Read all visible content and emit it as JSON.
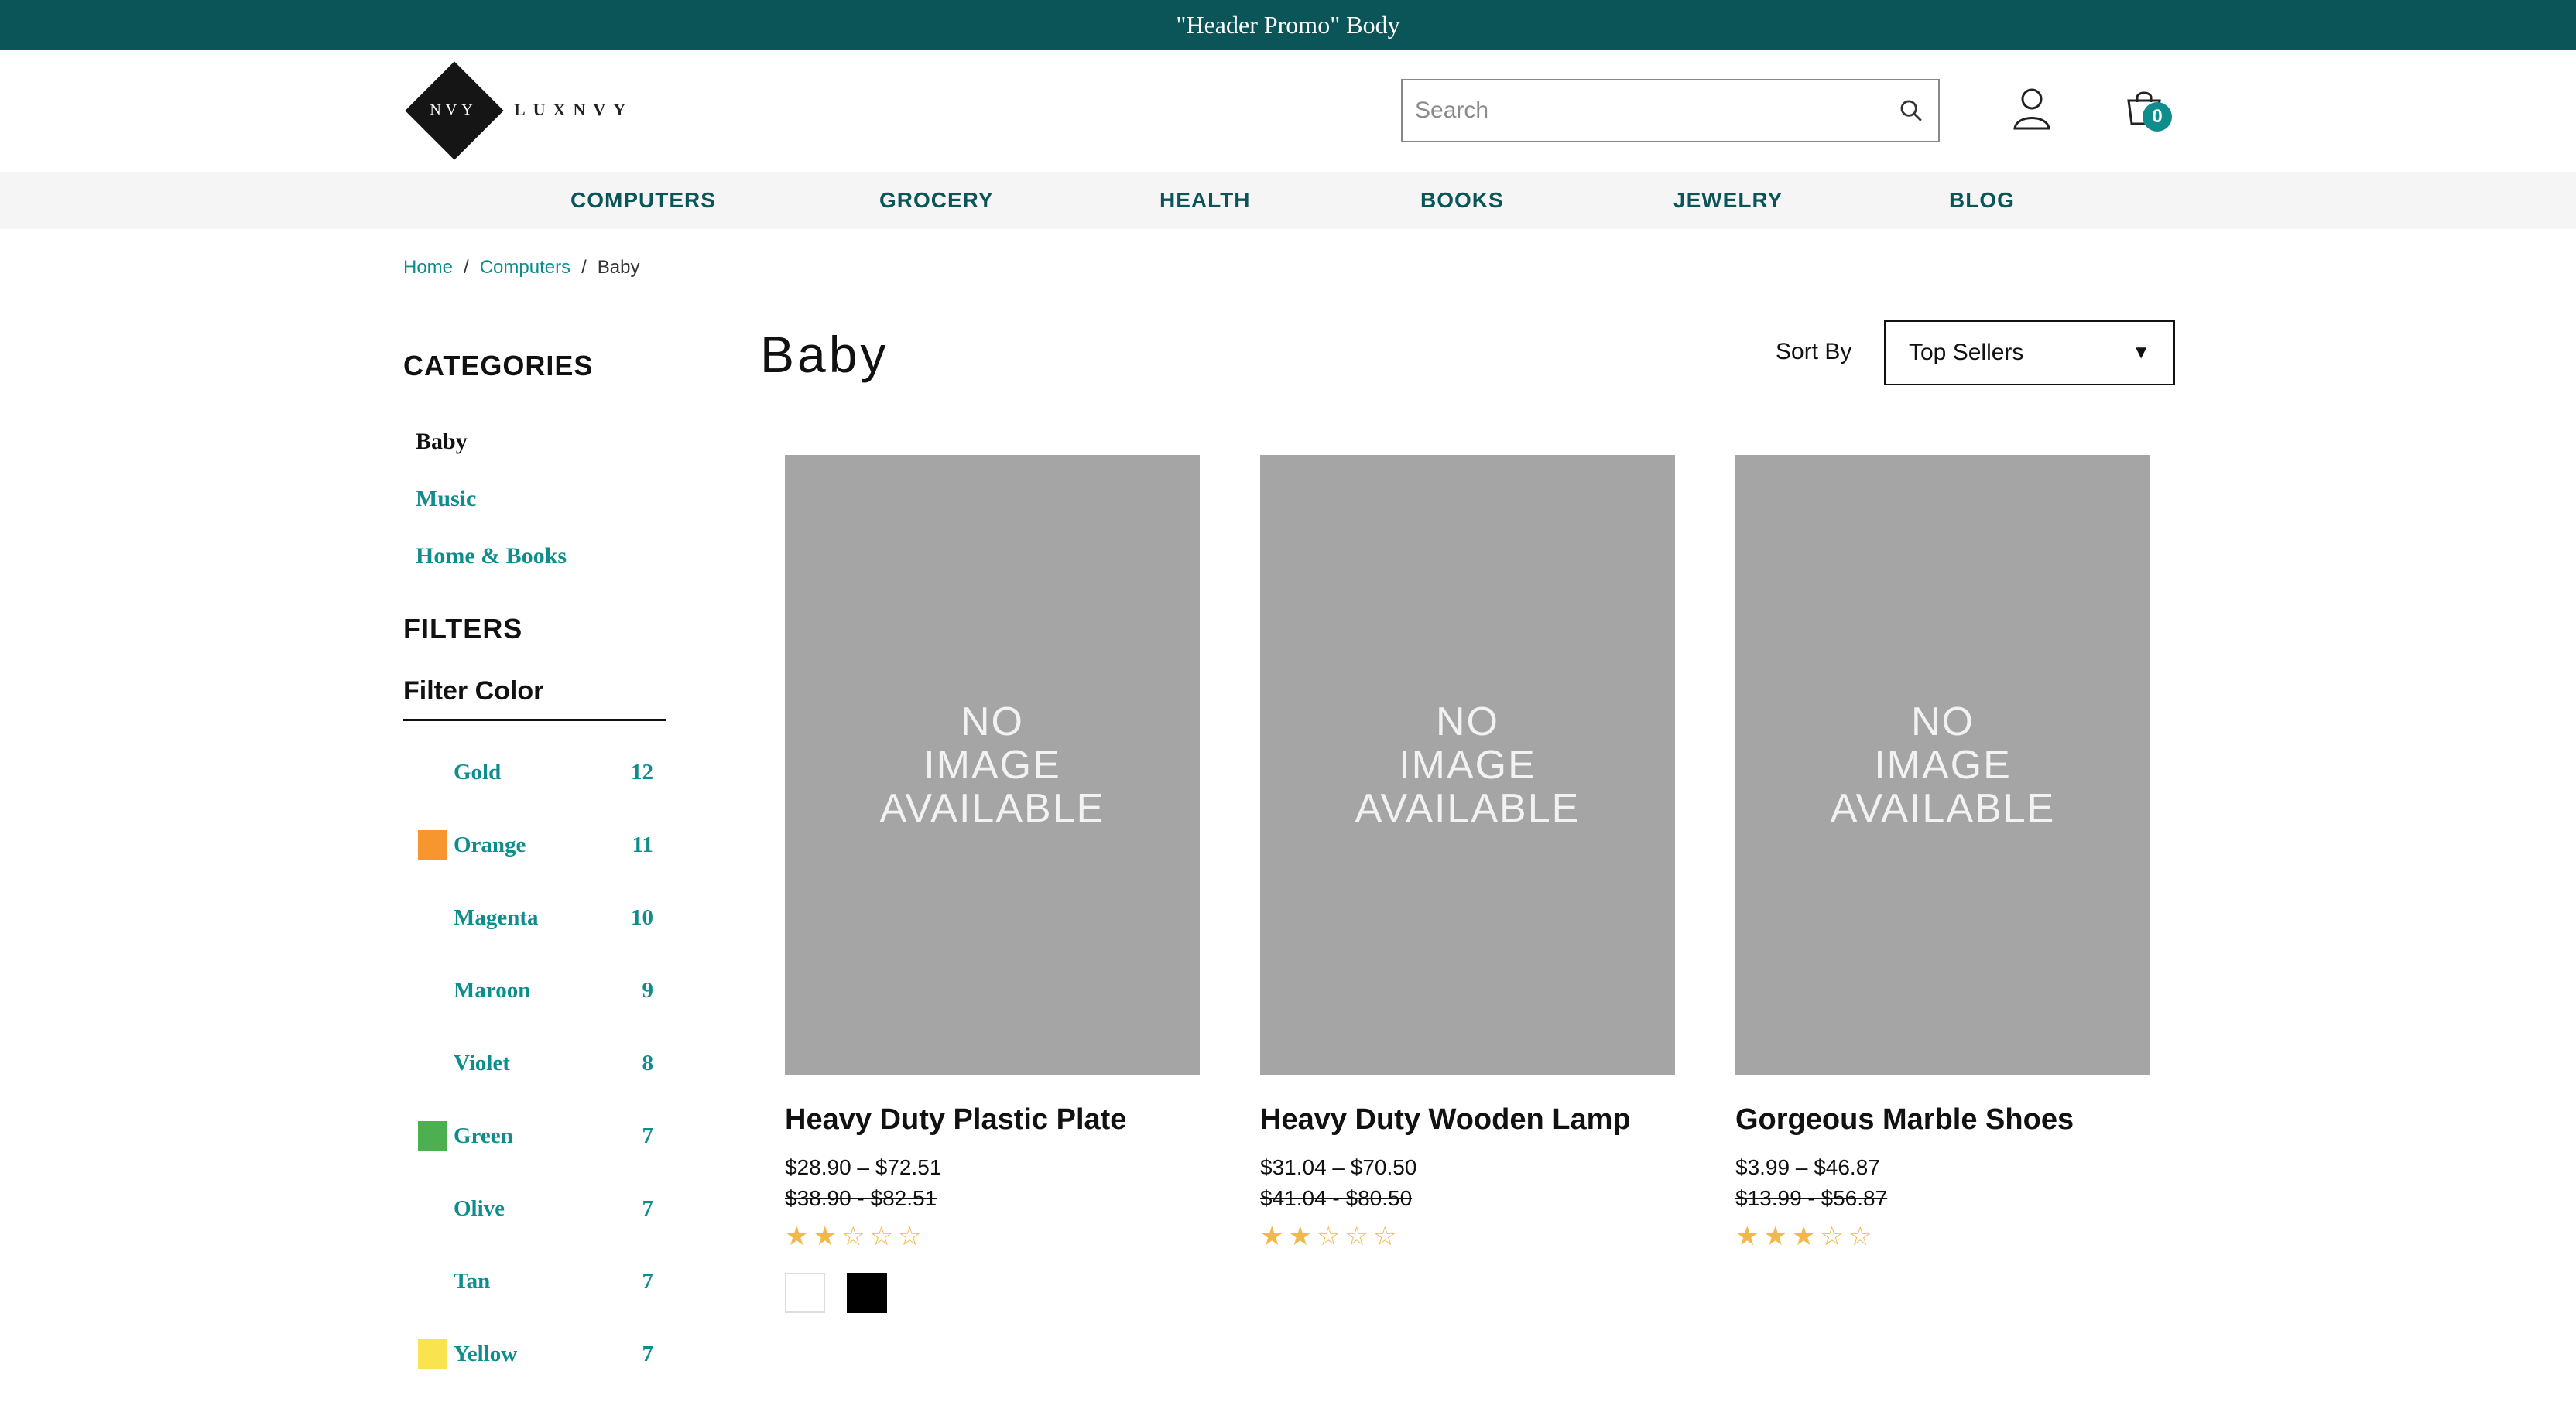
{
  "promo": {
    "text": "\"Header Promo\" Body"
  },
  "logo": {
    "monogram": "NVY",
    "wordmark": "LUXNVY"
  },
  "search": {
    "placeholder": "Search",
    "icon": "search-icon"
  },
  "cart": {
    "count": "0"
  },
  "nav": {
    "items": [
      {
        "label": "COMPUTERS"
      },
      {
        "label": "GROCERY"
      },
      {
        "label": "HEALTH"
      },
      {
        "label": "BOOKS"
      },
      {
        "label": "JEWELRY"
      },
      {
        "label": "BLOG"
      }
    ]
  },
  "breadcrumb": {
    "items": [
      "Home",
      "Computers",
      "Baby"
    ],
    "separator": "/"
  },
  "sidebar": {
    "categories_heading": "CATEGORIES",
    "categories": [
      "Baby",
      "Music",
      "Home & Books"
    ],
    "filters_heading": "FILTERS",
    "filter_color_heading": "Filter Color",
    "colors": [
      {
        "name": "Gold",
        "count": "12",
        "swatch": ""
      },
      {
        "name": "Orange",
        "count": "11",
        "swatch": "#f7962e"
      },
      {
        "name": "Magenta",
        "count": "10",
        "swatch": ""
      },
      {
        "name": "Maroon",
        "count": "9",
        "swatch": ""
      },
      {
        "name": "Violet",
        "count": "8",
        "swatch": ""
      },
      {
        "name": "Green",
        "count": "7",
        "swatch": "#4caf50"
      },
      {
        "name": "Olive",
        "count": "7",
        "swatch": ""
      },
      {
        "name": "Tan",
        "count": "7",
        "swatch": ""
      },
      {
        "name": "Yellow",
        "count": "7",
        "swatch": "#f9e34e"
      }
    ]
  },
  "main": {
    "title": "Baby",
    "sort_label": "Sort By",
    "sort_value": "Top Sellers",
    "products": [
      {
        "image_text": [
          "NO",
          "IMAGE",
          "AVAILABLE"
        ],
        "title": "Heavy Duty Plastic Plate",
        "price": "$28.90 – $72.51",
        "old_price": "$38.90 - $82.51",
        "rating": 2,
        "swatches": [
          "#ffffff",
          "#000000"
        ]
      },
      {
        "image_text": [
          "NO",
          "IMAGE",
          "AVAILABLE"
        ],
        "title": "Heavy Duty Wooden Lamp",
        "price": "$31.04 – $70.50",
        "old_price": "$41.04 - $80.50",
        "rating": 2,
        "swatches": []
      },
      {
        "image_text": [
          "NO",
          "IMAGE",
          "AVAILABLE"
        ],
        "title": "Gorgeous Marble Shoes",
        "price": "$3.99 – $46.87",
        "old_price": "$13.99 - $56.87",
        "rating": 3.5,
        "swatches": []
      }
    ]
  },
  "colors": {
    "brand_dark": "#0b5559",
    "accent": "#0f8d8d",
    "star": "#f2b84b",
    "placeholder_bg": "#a5a5a5"
  }
}
